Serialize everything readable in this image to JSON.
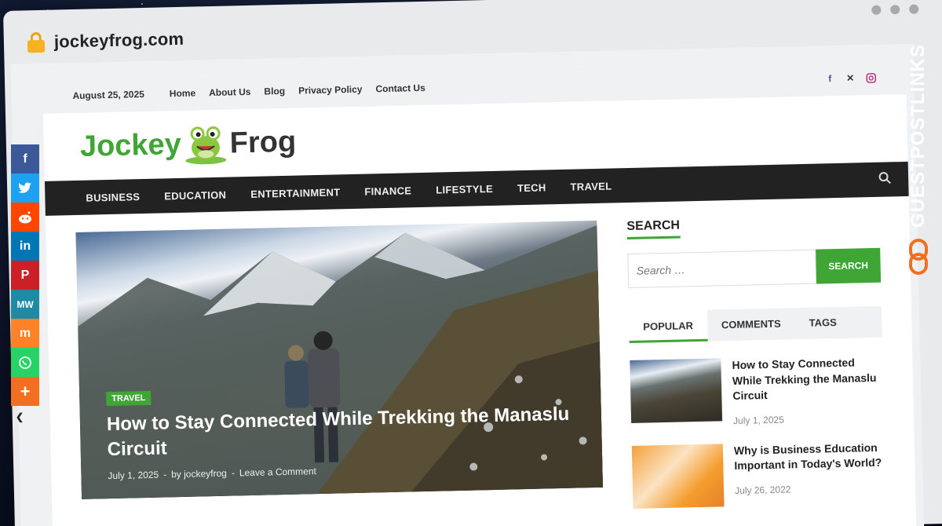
{
  "browser": {
    "url": "jockeyfrog.com"
  },
  "topbar": {
    "date": "August 25, 2025",
    "links": [
      "Home",
      "About Us",
      "Blog",
      "Privacy Policy",
      "Contact Us"
    ],
    "social_icons": [
      "facebook-icon",
      "x-icon",
      "instagram-icon"
    ]
  },
  "logo": {
    "part1": "Jockey",
    "part2": "Frog"
  },
  "nav": [
    "BUSINESS",
    "EDUCATION",
    "ENTERTAINMENT",
    "FINANCE",
    "LIFESTYLE",
    "TECH",
    "TRAVEL"
  ],
  "hero": {
    "category": "TRAVEL",
    "title": "How to Stay Connected While Trekking the Manaslu Circuit",
    "date": "July 1, 2025",
    "sep": "-",
    "author": "by jockeyfrog",
    "comment": "Leave a Comment"
  },
  "sidebar": {
    "search_title": "SEARCH",
    "search_placeholder": "Search …",
    "search_button": "SEARCH",
    "tabs": [
      "POPULAR",
      "COMMENTS",
      "TAGS"
    ],
    "posts": [
      {
        "title": "How to Stay Connected While Trekking the Manaslu Circuit",
        "date": "July 1, 2025"
      },
      {
        "title": "Why is Business Education Important in Today's World?",
        "date": "July 26, 2022"
      }
    ]
  },
  "share_bar": {
    "buttons": [
      {
        "icon": "facebook-icon",
        "glyph": "f",
        "color": "#3b5998"
      },
      {
        "icon": "twitter-icon",
        "glyph": "t",
        "color": "#1da1f2"
      },
      {
        "icon": "reddit-icon",
        "glyph": "r",
        "color": "#ff4500"
      },
      {
        "icon": "linkedin-icon",
        "glyph": "in",
        "color": "#0077b5"
      },
      {
        "icon": "pinterest-icon",
        "glyph": "P",
        "color": "#cb2027"
      },
      {
        "icon": "mewe-icon",
        "glyph": "MW",
        "color": "#1f8aa5"
      },
      {
        "icon": "mix-icon",
        "glyph": "m",
        "color": "#ff8226"
      },
      {
        "icon": "whatsapp-icon",
        "glyph": "w",
        "color": "#25d366"
      },
      {
        "icon": "more-icon",
        "glyph": "+",
        "color": "#f26e21"
      }
    ]
  },
  "watermark": {
    "text": "GUESTPOSTLINKS"
  },
  "colors": {
    "accent": "#3fa535",
    "nav_bg": "#222222",
    "link_orange": "#f26e21"
  }
}
